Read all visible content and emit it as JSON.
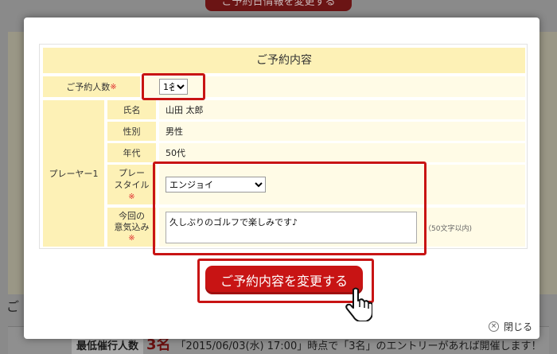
{
  "background": {
    "top_button": "ご予約日情報を変更する",
    "section_prefix": "ご",
    "min_label": "最低催行人数",
    "min_count": "3名",
    "notice": "「2015/06/03(水) 17:00」時点で「3名」のエントリーがあれば開催します！"
  },
  "form": {
    "title": "ご予約内容",
    "people_label": "ご予約人数",
    "required_mark": "※",
    "people_value": "1名",
    "player_label": "プレーヤー1",
    "name_label": "氏名",
    "name_value": "山田 太郎",
    "gender_label": "性別",
    "gender_value": "男性",
    "age_label": "年代",
    "age_value": "50代",
    "style_label_1": "プレー",
    "style_label_2": "スタイル",
    "style_value": "エンジョイ",
    "motivation_label_1": "今回の",
    "motivation_label_2": "意気込み",
    "motivation_value": "久しぶりのゴルフで楽しみです♪",
    "motivation_hint": "（50文字以内)"
  },
  "submit_label": "ご予約内容を変更する",
  "close_label": "閉じる",
  "colors": {
    "accent": "#c81414",
    "label_bg": "#fdf1b6",
    "value_bg": "#fffbe6"
  }
}
